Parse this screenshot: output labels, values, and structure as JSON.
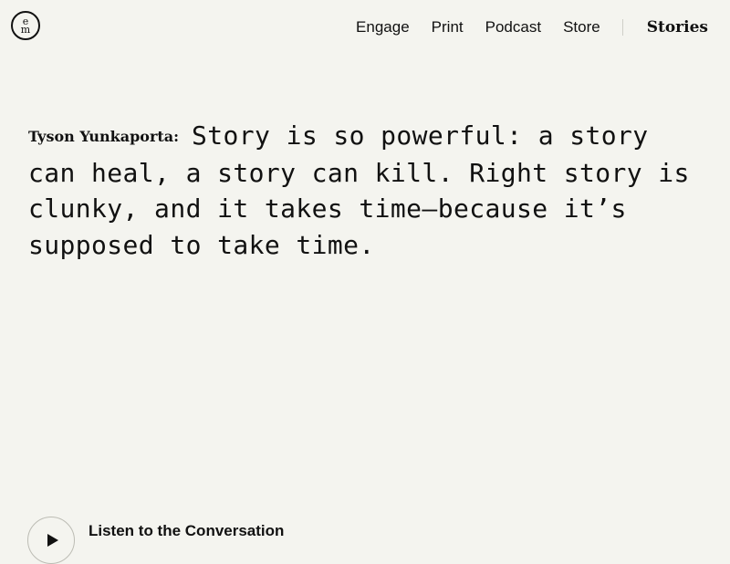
{
  "header": {
    "logo_top": "e",
    "logo_bottom": "m",
    "nav": {
      "engage": "Engage",
      "print": "Print",
      "podcast": "Podcast",
      "store": "Store",
      "stories": "Stories"
    }
  },
  "quote": {
    "speaker": "Tyson Yunkaporta:",
    "text": "Story is so powerful: a story can heal, a story can kill. Right story is clunky, and it takes time—because it’s supposed to take time."
  },
  "player": {
    "play_icon": "play-icon",
    "label": "Listen to the Conversation"
  }
}
